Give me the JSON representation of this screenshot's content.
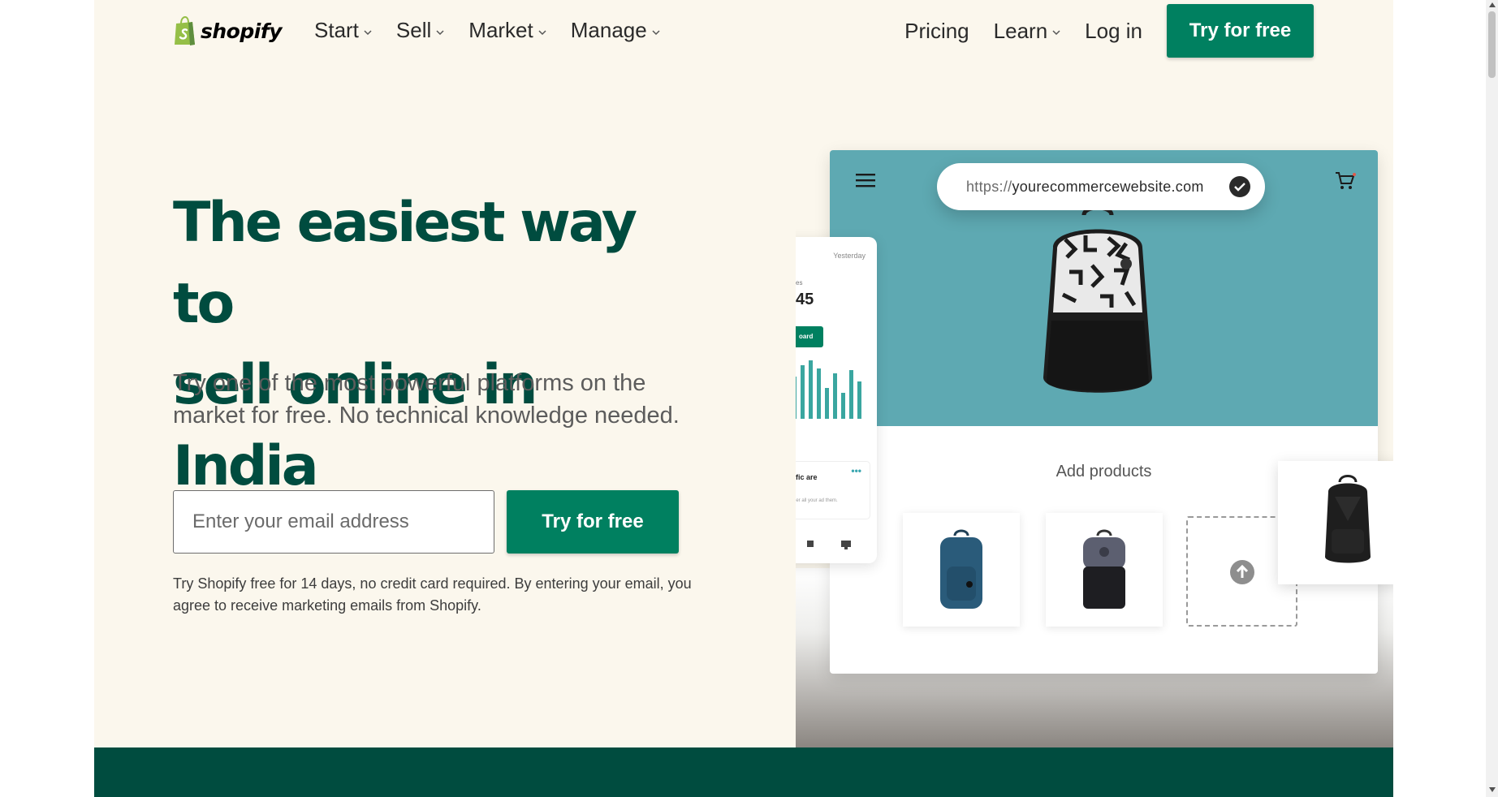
{
  "brand": {
    "name": "shopify",
    "colors": {
      "primary": "#008060",
      "heading": "#004c3f",
      "background": "#fbf7ed",
      "logo_green": "#95bf47"
    }
  },
  "nav": {
    "left_items": [
      {
        "label": "Start",
        "icon": "chevron-down-icon"
      },
      {
        "label": "Sell",
        "icon": "chevron-down-icon"
      },
      {
        "label": "Market",
        "icon": "chevron-down-icon"
      },
      {
        "label": "Manage",
        "icon": "chevron-down-icon"
      }
    ],
    "pricing": "Pricing",
    "learn": "Learn",
    "login": "Log in",
    "cta": "Try for free"
  },
  "hero": {
    "title_line1": "The easiest way to",
    "title_line2": "sell online in India",
    "subtitle": "Try one of the most powerful platforms on the market for free. No technical knowledge needed.",
    "email_placeholder": "Enter your email address",
    "cta": "Try for free",
    "note": "Try Shopify free for 14 days, no credit card required. By entering your email, you agree to receive marketing emails from Shopify."
  },
  "illustration": {
    "url_protocol": "https://",
    "url_domain": "yourecommercewebsite.com",
    "add_products": "Add products",
    "admin_yesterday": "Yesterday",
    "admin_stat_label": "es",
    "admin_stat_value": "45",
    "admin_button": "oard",
    "admin_traffic": "ffic are",
    "admin_traffic_desc": "her all your ad them.",
    "admin_dots": "•••"
  }
}
